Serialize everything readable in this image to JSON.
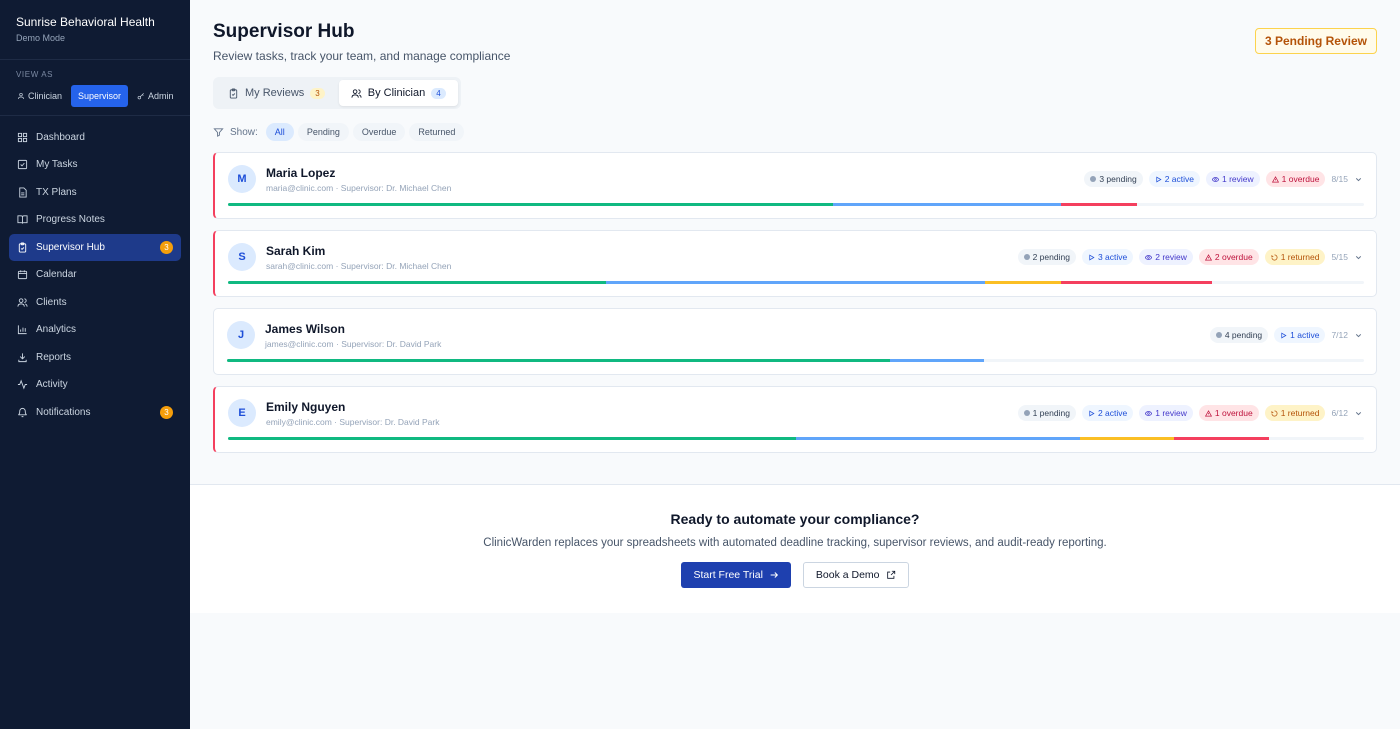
{
  "org": {
    "name": "Sunrise Behavioral Health",
    "mode": "Demo Mode"
  },
  "view_as": {
    "label": "VIEW AS",
    "roles": [
      {
        "label": "Clinician",
        "icon": "user-icon",
        "active": false
      },
      {
        "label": "Supervisor",
        "icon": "",
        "active": true
      },
      {
        "label": "Admin",
        "icon": "key-icon",
        "active": false
      }
    ]
  },
  "nav": [
    {
      "label": "Dashboard",
      "icon": "grid-icon",
      "badge": ""
    },
    {
      "label": "My Tasks",
      "icon": "check-square-icon",
      "badge": ""
    },
    {
      "label": "TX Plans",
      "icon": "file-icon",
      "badge": ""
    },
    {
      "label": "Progress Notes",
      "icon": "book-icon",
      "badge": ""
    },
    {
      "label": "Supervisor Hub",
      "icon": "clipboard-icon",
      "badge": "3",
      "active": true
    },
    {
      "label": "Calendar",
      "icon": "calendar-icon",
      "badge": ""
    },
    {
      "label": "Clients",
      "icon": "users-icon",
      "badge": ""
    },
    {
      "label": "Analytics",
      "icon": "bar-chart-icon",
      "badge": ""
    },
    {
      "label": "Reports",
      "icon": "download-icon",
      "badge": ""
    },
    {
      "label": "Activity",
      "icon": "activity-icon",
      "badge": ""
    },
    {
      "label": "Notifications",
      "icon": "bell-icon",
      "badge": "3"
    }
  ],
  "header": {
    "title": "Supervisor Hub",
    "subtitle": "Review tasks, track your team, and manage compliance",
    "pending_badge": "3 Pending Review"
  },
  "tabs": [
    {
      "label": "My Reviews",
      "count": "3",
      "active": false
    },
    {
      "label": "By Clinician",
      "count": "4",
      "active": true
    }
  ],
  "filters": {
    "label": "Show:",
    "options": [
      "All",
      "Pending",
      "Overdue",
      "Returned"
    ],
    "selected": "All"
  },
  "clinicians": [
    {
      "initial": "M",
      "name": "Maria Lopez",
      "email": "maria@clinic.com",
      "supervisor": "Supervisor: Dr. Michael Chen",
      "flag": true,
      "ratio": "8/15",
      "pills": [
        {
          "type": "pending",
          "label": "3 pending"
        },
        {
          "type": "active",
          "label": "2 active"
        },
        {
          "type": "review",
          "label": "1 review"
        },
        {
          "type": "overdue",
          "label": "1 overdue"
        }
      ],
      "progress": [
        {
          "color": "#10b981",
          "pct": 53.3
        },
        {
          "color": "#60a5fa",
          "pct": 20
        },
        {
          "color": "#f43f5e",
          "pct": 6.7
        }
      ]
    },
    {
      "initial": "S",
      "name": "Sarah Kim",
      "email": "sarah@clinic.com",
      "supervisor": "Supervisor: Dr. Michael Chen",
      "flag": true,
      "ratio": "5/15",
      "pills": [
        {
          "type": "pending",
          "label": "2 pending"
        },
        {
          "type": "active",
          "label": "3 active"
        },
        {
          "type": "review",
          "label": "2 review"
        },
        {
          "type": "overdue",
          "label": "2 overdue"
        },
        {
          "type": "returned",
          "label": "1 returned"
        }
      ],
      "progress": [
        {
          "color": "#10b981",
          "pct": 33.3
        },
        {
          "color": "#60a5fa",
          "pct": 33.3
        },
        {
          "color": "#fbbf24",
          "pct": 6.7
        },
        {
          "color": "#f43f5e",
          "pct": 13.3
        }
      ]
    },
    {
      "initial": "J",
      "name": "James Wilson",
      "email": "james@clinic.com",
      "supervisor": "Supervisor: Dr. David Park",
      "flag": false,
      "ratio": "7/12",
      "pills": [
        {
          "type": "pending",
          "label": "4 pending"
        },
        {
          "type": "active",
          "label": "1 active"
        }
      ],
      "progress": [
        {
          "color": "#10b981",
          "pct": 58.3
        },
        {
          "color": "#60a5fa",
          "pct": 8.3
        }
      ]
    },
    {
      "initial": "E",
      "name": "Emily Nguyen",
      "email": "emily@clinic.com",
      "supervisor": "Supervisor: Dr. David Park",
      "flag": true,
      "ratio": "6/12",
      "pills": [
        {
          "type": "pending",
          "label": "1 pending"
        },
        {
          "type": "active",
          "label": "2 active"
        },
        {
          "type": "review",
          "label": "1 review"
        },
        {
          "type": "overdue",
          "label": "1 overdue"
        },
        {
          "type": "returned",
          "label": "1 returned"
        }
      ],
      "progress": [
        {
          "color": "#10b981",
          "pct": 50
        },
        {
          "color": "#60a5fa",
          "pct": 25
        },
        {
          "color": "#fbbf24",
          "pct": 8.3
        },
        {
          "color": "#f43f5e",
          "pct": 8.3
        }
      ]
    }
  ],
  "cta": {
    "title": "Ready to automate your compliance?",
    "text": "ClinicWarden replaces your spreadsheets with automated deadline tracking, supervisor reviews, and audit-ready reporting.",
    "primary": "Start Free Trial",
    "secondary": "Book a Demo"
  }
}
